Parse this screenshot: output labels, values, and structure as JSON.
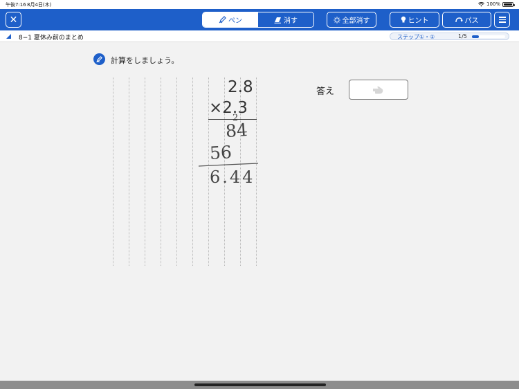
{
  "status_bar": {
    "time": "午後7:16",
    "date": "8月4日(木)",
    "battery": "100%",
    "icons": [
      "wifi-icon",
      "battery-icon"
    ]
  },
  "toolbar": {
    "close_icon": "close-icon",
    "pen_label": "ペン",
    "erase_label": "消す",
    "clear_all_label": "全部消す",
    "hint_label": "ヒント",
    "pass_label": "パス",
    "menu_icon": "hamburger-menu-icon",
    "accent": "#1e5fc9"
  },
  "subheader": {
    "lesson_title": "8−1 夏休み前のまとめ",
    "step_label": "ステップ①・②",
    "step_count": "1/5",
    "progress_fraction": 0.2
  },
  "question": {
    "text": "計算をしましょう。",
    "icon": "pencil-icon"
  },
  "problem": {
    "multiplicand": "2.8",
    "multiplier": "×2.3",
    "handwritten": {
      "carry": "2",
      "partial_one": "84",
      "partial_two": "56",
      "result": "6.44"
    }
  },
  "answer": {
    "label": "答え",
    "placeholder_icon": "hand-point-icon"
  }
}
